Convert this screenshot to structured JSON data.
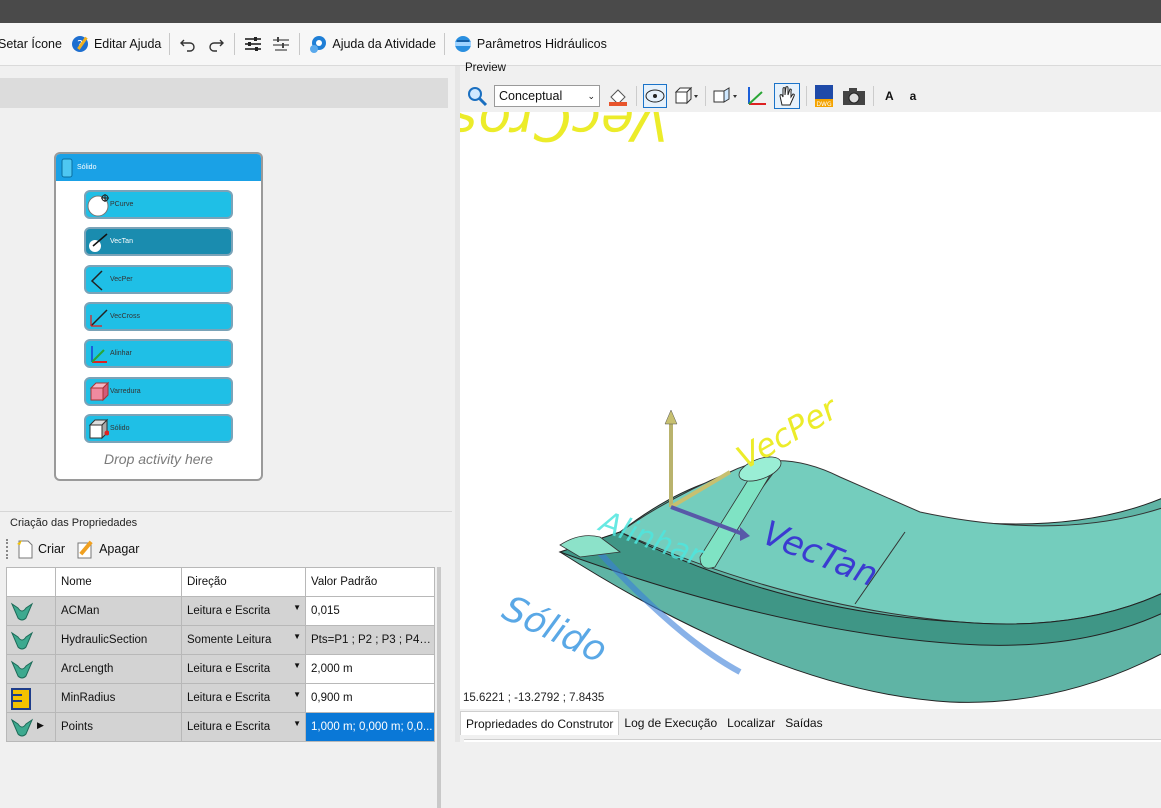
{
  "toolbar": {
    "set_icon_label": "Setar Ícone",
    "edit_help_label": "Editar Ajuda",
    "activity_help_label": "Ajuda da Atividade",
    "hydraulic_params_label": "Parâmetros Hidráulicos"
  },
  "designer": {
    "container_title": "Sólido",
    "activities": [
      {
        "label": "PCurve",
        "icon": "circle-point-icon"
      },
      {
        "label": "VecTan",
        "icon": "vector-tangent-icon"
      },
      {
        "label": "VecPer",
        "icon": "vector-perpendicular-icon"
      },
      {
        "label": "VecCross",
        "icon": "vector-cross-icon"
      },
      {
        "label": "Alinhar",
        "icon": "align-axes-icon"
      },
      {
        "label": "Varredura",
        "icon": "sweep-icon"
      },
      {
        "label": "Sólido",
        "icon": "solid-cube-icon"
      }
    ],
    "drop_hint": "Drop activity here"
  },
  "properties": {
    "title": "Criação das Propriedades",
    "create_label": "Criar",
    "delete_label": "Apagar",
    "columns": [
      "Nome",
      "Direção",
      "Valor Padrão"
    ],
    "rows": [
      {
        "name": "ACMan",
        "direction": "Leitura e Escrita",
        "value": "0,015",
        "icon": "section-green-icon"
      },
      {
        "name": "HydraulicSection",
        "direction": "Somente Leitura",
        "value": "Pts=P1 ; P2 ; P3 ; P4 ;...",
        "icon": "section-green-icon"
      },
      {
        "name": "ArcLength",
        "direction": "Leitura e Escrita",
        "value": "2,000 m",
        "icon": "section-green-icon"
      },
      {
        "name": "MinRadius",
        "direction": "Leitura e Escrita",
        "value": "0,900 m",
        "icon": "ruler-icon"
      },
      {
        "name": "Points",
        "direction": "Leitura e Escrita",
        "value": "1,000 m; 0,000 m; 0,0...",
        "icon": "section-green-icon"
      }
    ]
  },
  "preview": {
    "label": "Preview",
    "visual_style": "Conceptual",
    "font_large": "A",
    "font_small": "a",
    "coordinates": "15.6221 ; -13.2792 ; 7.8435",
    "scene_labels": [
      "VecCross",
      "VecPer",
      "VecTan",
      "Alinhar",
      "Sólido"
    ],
    "tabs": [
      "Propriedades do Construtor",
      "Log de Execução",
      "Localizar",
      "Saídas"
    ]
  },
  "colors": {
    "accent_blue": "#1aa1e6",
    "activity_fill": "#1fbfe6",
    "selected_row": "#0a78d7",
    "solid_green": "#6cc6b3"
  }
}
